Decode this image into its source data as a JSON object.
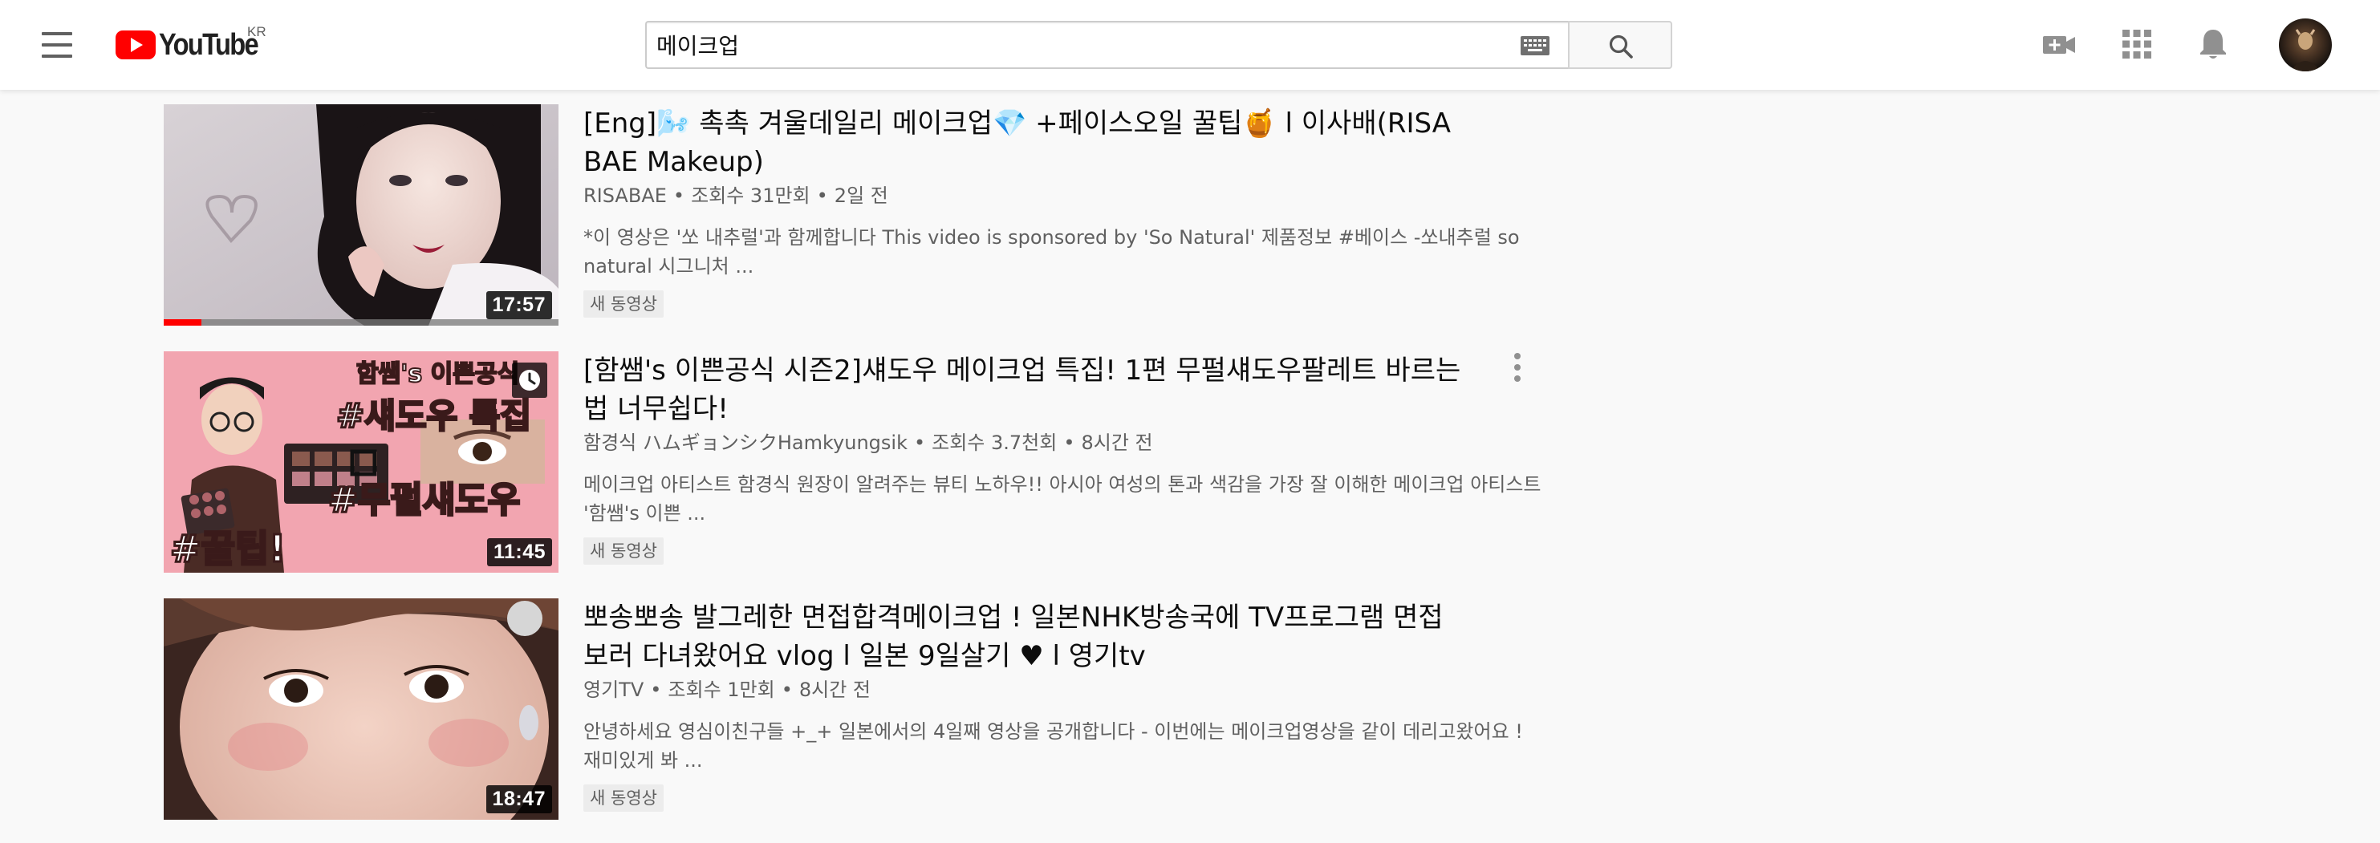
{
  "header": {
    "logo_text": "YouTube",
    "country_code": "KR",
    "search_value": "메이크업",
    "icons": [
      "menu-icon",
      "keyboard-icon",
      "search-icon",
      "create-video-icon",
      "apps-icon",
      "notifications-icon"
    ]
  },
  "results": [
    {
      "title": "[Eng]🌬️ 촉촉 겨울데일리 메이크업💎 +페이스오일 꿀팁🍯 l 이사배(RISABAE Makeup)",
      "channel": "RISABAE",
      "views": "조회수 31만회",
      "age": "2일 전",
      "description": "*이 영상은 '쏘 내추럴'과 함께합니다 This video is sponsored by 'So Natural' 제품정보 #베이스 -쏘내추럴 so natural 시그니처 ...",
      "badge": "새 동영상",
      "duration": "17:57",
      "watch_progress": 0.095
    },
    {
      "title": "[함쌤's 이쁜공식 시즌2]섀도우 메이크업 특집! 1편 무펄섀도우팔레트 바르는법 너무쉽다!",
      "channel": "함경식 ハムギョンシクHamkyungsik",
      "views": "조회수 3.7천회",
      "age": "8시간 전",
      "description": "메이크업 아티스트 함경식 원장이 알려주는 뷰티 노하우!! 아시아 여성의 톤과 색감을 가장 잘 이해한 메이크업 아티스트 '함쌤's 이쁜 ...",
      "badge": "새 동영상",
      "duration": "11:45",
      "thumb_text": {
        "top": "함쌤's 이쁜공식",
        "mid": "#섀도우 특집",
        "lower": "#무펄섀도우",
        "bottom": "#꿀팁!"
      }
    },
    {
      "title": "뽀송뽀송 발그레한 면접합격메이크업 ! 일본NHK방송국에 TV프로그램 면접보러 다녀왔어요 vlog l 일본 9일살기 ♥ l 영기tv",
      "channel": "영기TV",
      "views": "조회수 1만회",
      "age": "8시간 전",
      "description": "안녕하세요 영심이친구들 +_+ 일본에서의 4일째 영상을 공개합니다 - 이번에는 메이크업영상을 같이 데리고왔어요 ! 재미있게 봐 ...",
      "badge": "새 동영상",
      "duration": "18:47"
    }
  ],
  "colors": {
    "brand_red": "#ff0000",
    "text_primary": "#0d0d0d",
    "text_secondary": "#606060",
    "background": "#f9f9f9"
  }
}
